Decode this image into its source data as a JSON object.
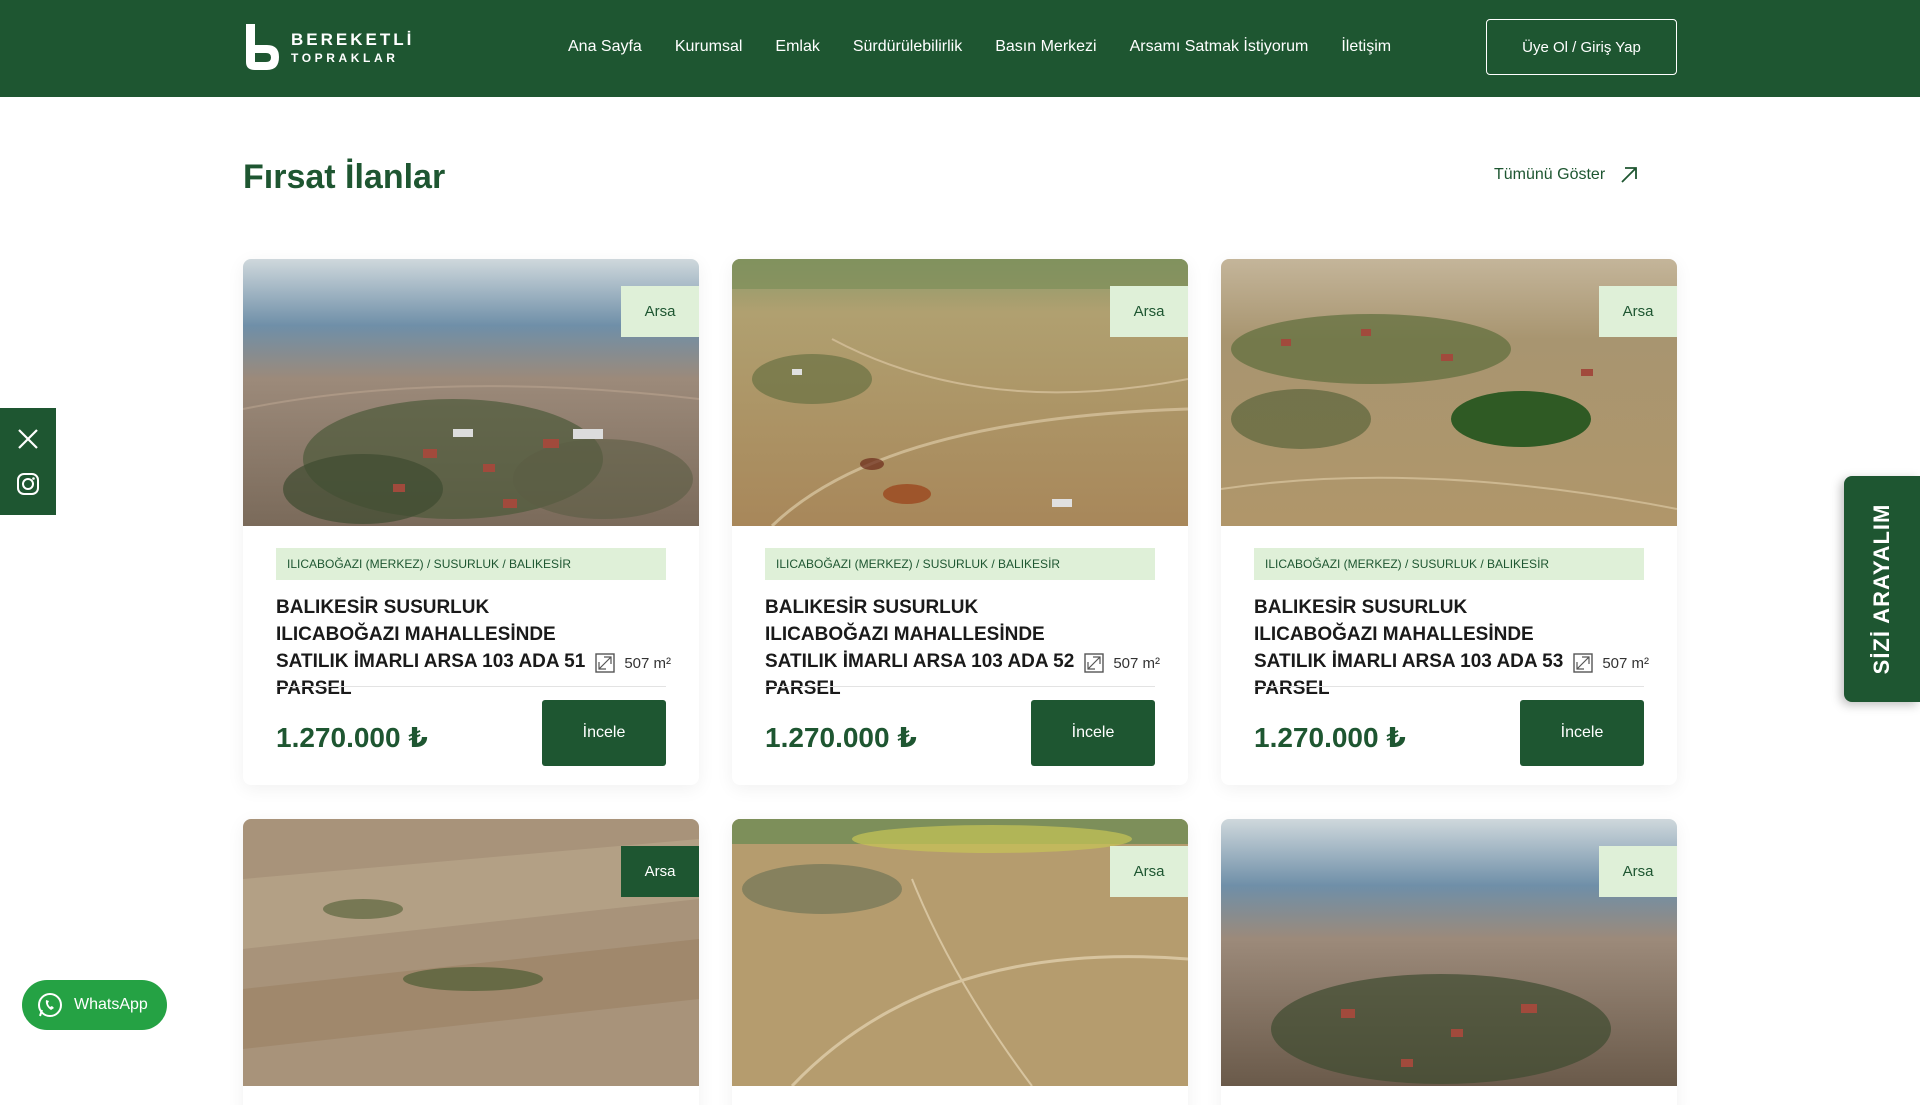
{
  "brand": {
    "line1": "BEREKETLİ",
    "line2": "TOPRAKLAR"
  },
  "nav": {
    "items": [
      {
        "label": "Ana Sayfa"
      },
      {
        "label": "Kurumsal"
      },
      {
        "label": "Emlak"
      },
      {
        "label": "Sürdürülebilirlik"
      },
      {
        "label": "Basın Merkezi"
      },
      {
        "label": "Arsamı Satmak İstiyorum"
      },
      {
        "label": "İletişim"
      }
    ],
    "login_label": "Üye Ol / Giriş Yap"
  },
  "section": {
    "title": "Fırsat İlanlar",
    "show_all": "Tümünü Göster"
  },
  "listings": [
    {
      "badge": "Arsa",
      "location": "ILICABOĞAZI (MERKEZ) / SUSURLUK / BALIKESİR",
      "title": "BALIKESİR SUSURLUK ILICABOĞAZI MAHALLESİNDE SATILIK İMARLI ARSA 103 ADA 51 PARSEL",
      "area": "507 m²",
      "price": "1.270.000 ₺",
      "button": "İncele"
    },
    {
      "badge": "Arsa",
      "location": "ILICABOĞAZI (MERKEZ) / SUSURLUK / BALIKESİR",
      "title": "BALIKESİR SUSURLUK ILICABOĞAZI MAHALLESİNDE SATILIK İMARLI ARSA 103 ADA 52 PARSEL",
      "area": "507 m²",
      "price": "1.270.000 ₺",
      "button": "İncele"
    },
    {
      "badge": "Arsa",
      "location": "ILICABOĞAZI (MERKEZ) / SUSURLUK / BALIKESİR",
      "title": "BALIKESİR SUSURLUK ILICABOĞAZI MAHALLESİNDE SATILIK İMARLI ARSA 103 ADA 53 PARSEL",
      "area": "507 m²",
      "price": "1.270.000 ₺",
      "button": "İncele"
    },
    {
      "badge": "Arsa"
    },
    {
      "badge": "Arsa"
    },
    {
      "badge": "Arsa"
    }
  ],
  "whatsapp": {
    "label": "WhatsApp"
  },
  "call_tab": {
    "label": "SİZİ ARAYALIM"
  },
  "icons": {
    "social": [
      "x-icon",
      "instagram-icon"
    ],
    "show_all": "arrow-up-right-icon",
    "area": "area-icon"
  },
  "colors": {
    "primary": "#1e5631",
    "light_green": "#dff0d8",
    "whatsapp": "#25a244"
  }
}
